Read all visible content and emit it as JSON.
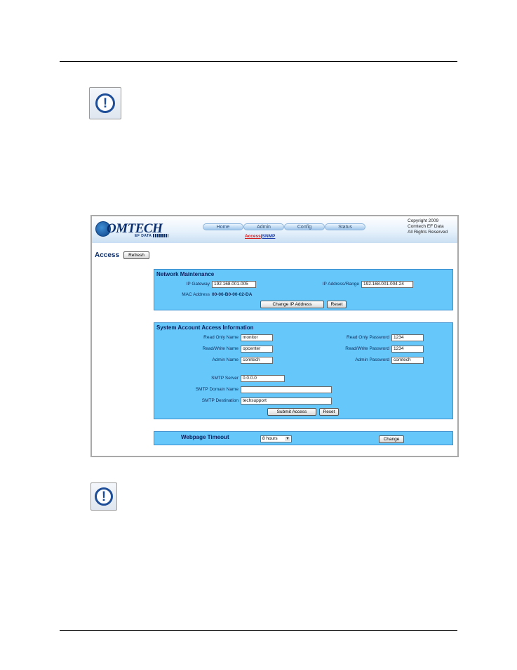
{
  "ui": {
    "logo": {
      "name": "OMTECH",
      "sub": "EF DATA"
    },
    "nav_tabs": [
      "Home",
      "Admin",
      "Config",
      "Status"
    ],
    "subnav": {
      "active": "Access",
      "separator": "|",
      "link": "SNMP"
    },
    "copyright": [
      "Copyright 2009",
      "Comtech EF Data",
      "All Rights Reserved"
    ],
    "page_title": "Access",
    "refresh_label": "Refresh",
    "network": {
      "title": "Network Maintenance",
      "ip_gateway_label": "IP Gateway",
      "ip_gateway_value": "192.168.001.005",
      "ip_range_label": "IP Address/Range",
      "ip_range_value": "192.168.001.004.24",
      "mac_label": "MAC Address",
      "mac_value": "00-06-B0-00-02-DA",
      "change_ip_label": "Change IP Address",
      "reset_label": "Reset"
    },
    "accounts": {
      "title": "System Account Access Information",
      "ro_name_label": "Read Only Name",
      "ro_name_value": "monitor",
      "ro_pass_label": "Read Only Password",
      "ro_pass_value": "1234",
      "rw_name_label": "Read/Write Name",
      "rw_name_value": "opcenter",
      "rw_pass_label": "Read/Write Password",
      "rw_pass_value": "1234",
      "admin_name_label": "Admin Name",
      "admin_name_value": "comtech",
      "admin_pass_label": "Admin Password",
      "admin_pass_value": "comtech",
      "smtp_server_label": "SMTP Server",
      "smtp_server_value": "0.0.0.0",
      "smtp_domain_label": "SMTP Domain Name",
      "smtp_domain_value": "",
      "smtp_dest_label": "SMTP Destination",
      "smtp_dest_value": "techsupport",
      "submit_label": "Submit Access",
      "reset_label": "Reset"
    },
    "timeout": {
      "label": "Webpage Timeout",
      "selected": "8 hours",
      "change_label": "Change"
    }
  },
  "colors": {
    "panel": "#66c8fa",
    "brand": "#0b2f6e",
    "notice_icon": "#1f4e99"
  }
}
